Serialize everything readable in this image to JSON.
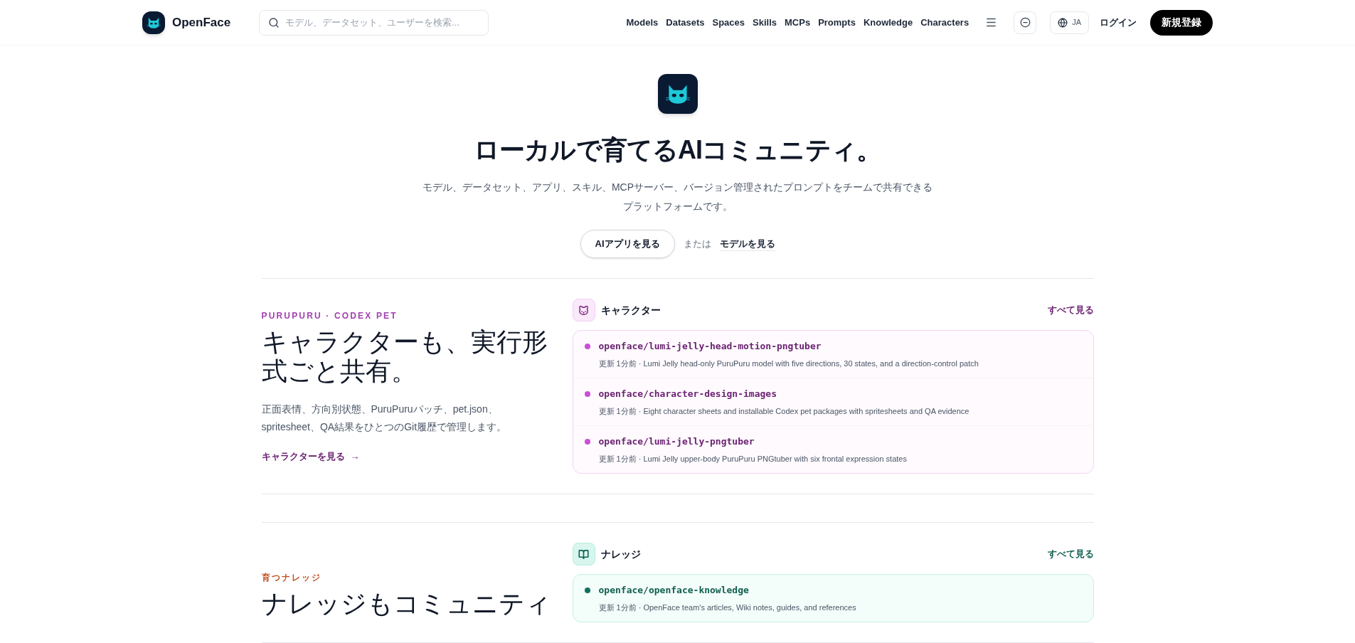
{
  "header": {
    "brand": "OpenFace",
    "search": {
      "placeholder": "モデル、データセット、ユーザーを検索..."
    },
    "nav": [
      "Models",
      "Datasets",
      "Spaces",
      "Skills",
      "MCPs",
      "Prompts",
      "Knowledge",
      "Characters"
    ],
    "language": "JA",
    "login": "ログイン",
    "signup": "新規登録"
  },
  "hero": {
    "title": "ローカルで育てるAIコミュニティ。",
    "subtitle": "モデル、データセット、アプリ、スキル、MCPサーバー、バージョン管理されたプロンプトをチームで共有できるプラットフォームです。",
    "primary_button": "AIアプリを見る",
    "separator": "または",
    "secondary_link": "モデルを見る"
  },
  "sections": [
    {
      "kind": "character",
      "eyebrow": "PURUPURU · CODEX PET",
      "title": "キャラクターも、実行形式ごと共有。",
      "description": "正面表情、方向別状態、PuruPuruパッチ、pet.json、spritesheet、QA結果をひとつのGit履歴で管理します。",
      "link": "キャラクターを見る",
      "arrow": "→",
      "panel_title": "キャラクター",
      "see_all": "すべて見る",
      "items": [
        {
          "name": "openface/lumi-jelly-head-motion-pngtuber",
          "meta": "更新 1分前 · Lumi Jelly head-only PuruPuru model with five directions, 30 states, and a direction-control patch"
        },
        {
          "name": "openface/character-design-images",
          "meta": "更新 1分前 · Eight character sheets and installable Codex pet packages with spritesheets and QA evidence"
        },
        {
          "name": "openface/lumi-jelly-pngtuber",
          "meta": "更新 1分前 · Lumi Jelly upper-body PuruPuru PNGtuber with six frontal expression states"
        }
      ]
    },
    {
      "kind": "knowledge",
      "eyebrow": "育つナレッジ",
      "title": "ナレッジもコミュニティ",
      "panel_title": "ナレッジ",
      "see_all": "すべて見る",
      "items": [
        {
          "name": "openface/openface-knowledge",
          "meta": "更新 1分前 · OpenFace team's articles, Wiki notes, guides, and references"
        }
      ]
    }
  ]
}
